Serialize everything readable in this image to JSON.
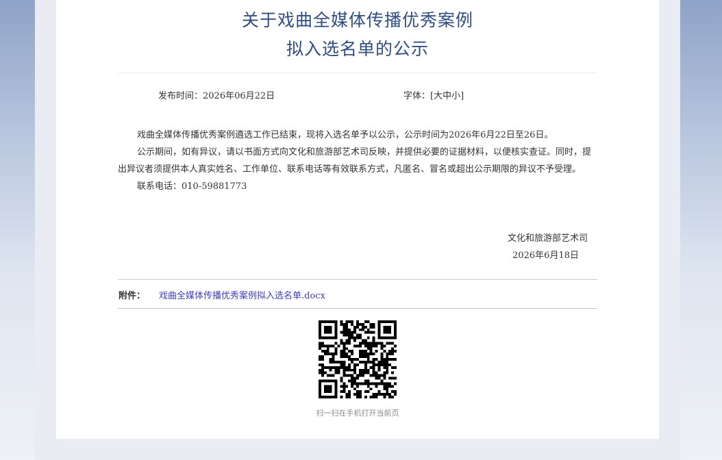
{
  "title": {
    "line1": "关于戏曲全媒体传播优秀案例",
    "line2": "拟入选名单的公示"
  },
  "meta": {
    "date_label": "发布时间：",
    "date_value": "2026年06月22日",
    "font_label": "字体：",
    "bracket_open": "[",
    "bracket_close": "]",
    "size_large": "大",
    "size_medium": "中",
    "size_small": "小"
  },
  "body": {
    "p1": "戏曲全媒体传播优秀案例遴选工作已结束，现将入选名单予以公示，公示时间为2026年6月22日至26日。",
    "p2": "公示期间，如有异议，请以书面方式向文化和旅游部艺术司反映，并提供必要的证据材料，以便核实查证。同时，提出异议者须提供本人真实姓名、工作单位、联系电话等有效联系方式，凡匿名、冒名或超出公示期限的异议不予受理。",
    "p3": "联系电话：010-59881773"
  },
  "signature": {
    "org": "文化和旅游部艺术司",
    "date": "2026年6月18日"
  },
  "attachment": {
    "label": "附件：",
    "file_name": "戏曲全媒体传播优秀案例拟入选名单.docx"
  },
  "qr": {
    "caption": "扫一扫在手机打开当前页"
  }
}
